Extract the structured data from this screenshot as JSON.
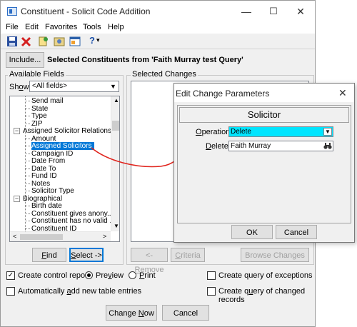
{
  "window": {
    "title": "Constituent - Solicit Code Addition"
  },
  "window_controls": {
    "minimize": "—",
    "maximize": "☐",
    "close": "✕"
  },
  "menu": [
    "File",
    "Edit",
    "Favorites",
    "Tools",
    "Help"
  ],
  "toolbar": {
    "help_label": "?",
    "dropdown_arrow": "▾"
  },
  "include_button": "Include...",
  "query_heading": "Selected Constituents from 'Faith Murray test Query'",
  "available_fields": {
    "label": "Available Fields",
    "show_label": "Show:",
    "show_value": "<All fields>",
    "tree": [
      {
        "label": "Send mail",
        "depth": 2
      },
      {
        "label": "State",
        "depth": 2
      },
      {
        "label": "Type",
        "depth": 2
      },
      {
        "label": "ZIP",
        "depth": 2
      },
      {
        "label": "Assigned Solicitor Relations...",
        "depth": 1,
        "expander": "−"
      },
      {
        "label": "Amount",
        "depth": 2
      },
      {
        "label": "Assigned Solicitors",
        "depth": 2,
        "selected": true
      },
      {
        "label": "Campaign ID",
        "depth": 2
      },
      {
        "label": "Date From",
        "depth": 2
      },
      {
        "label": "Date To",
        "depth": 2
      },
      {
        "label": "Fund ID",
        "depth": 2
      },
      {
        "label": "Notes",
        "depth": 2
      },
      {
        "label": "Solicitor Type",
        "depth": 2
      },
      {
        "label": "Biographical",
        "depth": 1,
        "expander": "−"
      },
      {
        "label": "Birth date",
        "depth": 2
      },
      {
        "label": "Constituent gives anony...",
        "depth": 2
      },
      {
        "label": "Constituent has no valid ...",
        "depth": 2
      },
      {
        "label": "Constituent ID",
        "depth": 2
      }
    ],
    "find_button": "Find",
    "select_button": "Select ->"
  },
  "selected_changes": {
    "label": "Selected Changes",
    "remove_button": "<- Remove",
    "criteria_button": "Criteria",
    "browse_button": "Browse Changes"
  },
  "options": {
    "create_control_report": {
      "label": "Create control report",
      "checked": true
    },
    "preview": {
      "label": "Preview",
      "selected": true
    },
    "print": {
      "label": "Print",
      "selected": false
    },
    "create_query_exceptions": {
      "label": "Create query of exceptions",
      "checked": false
    },
    "auto_add_table_entries": {
      "label": "Automatically add new table entries",
      "checked": false
    },
    "create_query_changed": {
      "label": "Create query of changed records",
      "checked": false
    }
  },
  "change_now_button": "Change Now",
  "cancel_button": "Cancel",
  "dialog": {
    "title": "Edit Change Parameters",
    "close": "✕",
    "header": "Solicitor",
    "operation_label": "Operation:",
    "operation_value": "Delete",
    "delete_label": "Delete:",
    "delete_value": "Faith Murray",
    "ok_button": "OK",
    "cancel_button": "Cancel"
  },
  "colors": {
    "selection": "#0078d7",
    "operation_highlight": "#00e5ff",
    "annotation_arrow": "#e0231c"
  }
}
